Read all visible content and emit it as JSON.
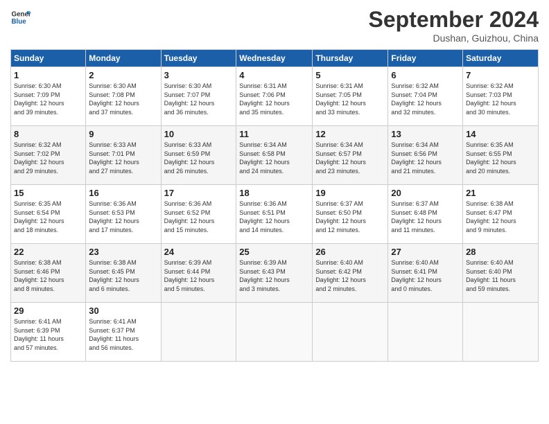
{
  "header": {
    "logo_line1": "General",
    "logo_line2": "Blue",
    "month": "September 2024",
    "location": "Dushan, Guizhou, China"
  },
  "weekdays": [
    "Sunday",
    "Monday",
    "Tuesday",
    "Wednesday",
    "Thursday",
    "Friday",
    "Saturday"
  ],
  "weeks": [
    [
      {
        "day": "1",
        "info": "Sunrise: 6:30 AM\nSunset: 7:09 PM\nDaylight: 12 hours\nand 39 minutes."
      },
      {
        "day": "2",
        "info": "Sunrise: 6:30 AM\nSunset: 7:08 PM\nDaylight: 12 hours\nand 37 minutes."
      },
      {
        "day": "3",
        "info": "Sunrise: 6:30 AM\nSunset: 7:07 PM\nDaylight: 12 hours\nand 36 minutes."
      },
      {
        "day": "4",
        "info": "Sunrise: 6:31 AM\nSunset: 7:06 PM\nDaylight: 12 hours\nand 35 minutes."
      },
      {
        "day": "5",
        "info": "Sunrise: 6:31 AM\nSunset: 7:05 PM\nDaylight: 12 hours\nand 33 minutes."
      },
      {
        "day": "6",
        "info": "Sunrise: 6:32 AM\nSunset: 7:04 PM\nDaylight: 12 hours\nand 32 minutes."
      },
      {
        "day": "7",
        "info": "Sunrise: 6:32 AM\nSunset: 7:03 PM\nDaylight: 12 hours\nand 30 minutes."
      }
    ],
    [
      {
        "day": "8",
        "info": "Sunrise: 6:32 AM\nSunset: 7:02 PM\nDaylight: 12 hours\nand 29 minutes."
      },
      {
        "day": "9",
        "info": "Sunrise: 6:33 AM\nSunset: 7:01 PM\nDaylight: 12 hours\nand 27 minutes."
      },
      {
        "day": "10",
        "info": "Sunrise: 6:33 AM\nSunset: 6:59 PM\nDaylight: 12 hours\nand 26 minutes."
      },
      {
        "day": "11",
        "info": "Sunrise: 6:34 AM\nSunset: 6:58 PM\nDaylight: 12 hours\nand 24 minutes."
      },
      {
        "day": "12",
        "info": "Sunrise: 6:34 AM\nSunset: 6:57 PM\nDaylight: 12 hours\nand 23 minutes."
      },
      {
        "day": "13",
        "info": "Sunrise: 6:34 AM\nSunset: 6:56 PM\nDaylight: 12 hours\nand 21 minutes."
      },
      {
        "day": "14",
        "info": "Sunrise: 6:35 AM\nSunset: 6:55 PM\nDaylight: 12 hours\nand 20 minutes."
      }
    ],
    [
      {
        "day": "15",
        "info": "Sunrise: 6:35 AM\nSunset: 6:54 PM\nDaylight: 12 hours\nand 18 minutes."
      },
      {
        "day": "16",
        "info": "Sunrise: 6:36 AM\nSunset: 6:53 PM\nDaylight: 12 hours\nand 17 minutes."
      },
      {
        "day": "17",
        "info": "Sunrise: 6:36 AM\nSunset: 6:52 PM\nDaylight: 12 hours\nand 15 minutes."
      },
      {
        "day": "18",
        "info": "Sunrise: 6:36 AM\nSunset: 6:51 PM\nDaylight: 12 hours\nand 14 minutes."
      },
      {
        "day": "19",
        "info": "Sunrise: 6:37 AM\nSunset: 6:50 PM\nDaylight: 12 hours\nand 12 minutes."
      },
      {
        "day": "20",
        "info": "Sunrise: 6:37 AM\nSunset: 6:48 PM\nDaylight: 12 hours\nand 11 minutes."
      },
      {
        "day": "21",
        "info": "Sunrise: 6:38 AM\nSunset: 6:47 PM\nDaylight: 12 hours\nand 9 minutes."
      }
    ],
    [
      {
        "day": "22",
        "info": "Sunrise: 6:38 AM\nSunset: 6:46 PM\nDaylight: 12 hours\nand 8 minutes."
      },
      {
        "day": "23",
        "info": "Sunrise: 6:38 AM\nSunset: 6:45 PM\nDaylight: 12 hours\nand 6 minutes."
      },
      {
        "day": "24",
        "info": "Sunrise: 6:39 AM\nSunset: 6:44 PM\nDaylight: 12 hours\nand 5 minutes."
      },
      {
        "day": "25",
        "info": "Sunrise: 6:39 AM\nSunset: 6:43 PM\nDaylight: 12 hours\nand 3 minutes."
      },
      {
        "day": "26",
        "info": "Sunrise: 6:40 AM\nSunset: 6:42 PM\nDaylight: 12 hours\nand 2 minutes."
      },
      {
        "day": "27",
        "info": "Sunrise: 6:40 AM\nSunset: 6:41 PM\nDaylight: 12 hours\nand 0 minutes."
      },
      {
        "day": "28",
        "info": "Sunrise: 6:40 AM\nSunset: 6:40 PM\nDaylight: 11 hours\nand 59 minutes."
      }
    ],
    [
      {
        "day": "29",
        "info": "Sunrise: 6:41 AM\nSunset: 6:39 PM\nDaylight: 11 hours\nand 57 minutes."
      },
      {
        "day": "30",
        "info": "Sunrise: 6:41 AM\nSunset: 6:37 PM\nDaylight: 11 hours\nand 56 minutes."
      },
      {
        "day": "",
        "info": ""
      },
      {
        "day": "",
        "info": ""
      },
      {
        "day": "",
        "info": ""
      },
      {
        "day": "",
        "info": ""
      },
      {
        "day": "",
        "info": ""
      }
    ]
  ]
}
